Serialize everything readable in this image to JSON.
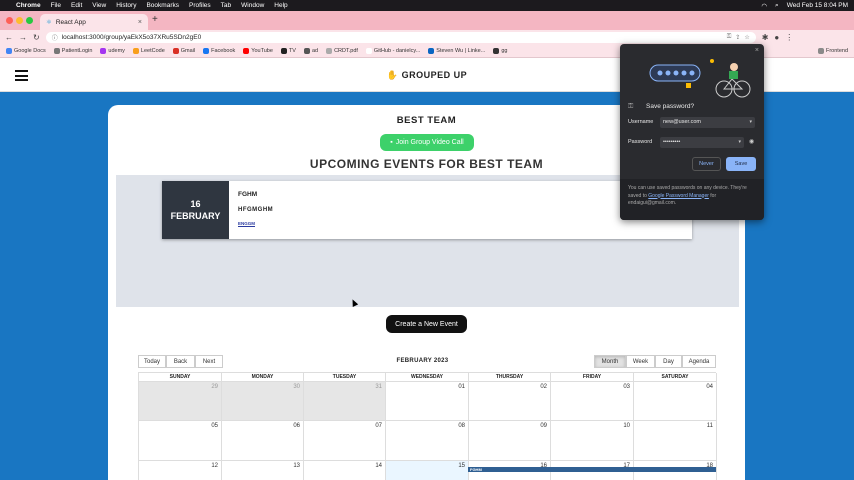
{
  "mac_menubar": {
    "app": "Chrome",
    "menus": [
      "File",
      "Edit",
      "View",
      "History",
      "Bookmarks",
      "Profiles",
      "Tab",
      "Window",
      "Help"
    ],
    "datetime": "Wed Feb 15  8:04 PM"
  },
  "browser": {
    "tab_title": "React App",
    "url": "localhost:3000/group/yaEkX5o37XRu5SDn2gE0",
    "bookmarks": [
      "Google Docs",
      "PatientLogin",
      "udemy",
      "LeetCode",
      "Gmail",
      "Facebook",
      "YouTube",
      "TV",
      "ad",
      "CRDT.pdf",
      "GitHub - danielcy...",
      "Steven Wu | Linke...",
      "gg",
      "Frontend"
    ]
  },
  "app": {
    "logo_text": "GROUPED UP",
    "team_name": "BEST TEAM",
    "video_call_label": "Join Group Video Call",
    "upcoming_title": "UPCOMING EVENTS FOR BEST TEAM",
    "create_event_label": "Create a New Event"
  },
  "event": {
    "day": "16",
    "month": "FEBRUARY",
    "title": "FGHM",
    "description": "HFGMGHM",
    "link": "ENGGM"
  },
  "calendar": {
    "nav_buttons": [
      "Today",
      "Back",
      "Next"
    ],
    "view_buttons": [
      "Month",
      "Week",
      "Day",
      "Agenda"
    ],
    "active_view": "Month",
    "month_title": "FEBRUARY 2023",
    "weekdays": [
      "SUNDAY",
      "MONDAY",
      "TUESDAY",
      "WEDNESDAY",
      "THURSDAY",
      "FRIDAY",
      "SATURDAY"
    ],
    "weeks": [
      [
        "29",
        "30",
        "31",
        "01",
        "02",
        "03",
        "04"
      ],
      [
        "05",
        "06",
        "07",
        "08",
        "09",
        "10",
        "11"
      ],
      [
        "12",
        "13",
        "14",
        "15",
        "16",
        "17",
        "18"
      ]
    ],
    "event_label": "FGHM"
  },
  "password_popup": {
    "heading": "Save password?",
    "username_label": "Username",
    "username_value": "new@user.com",
    "password_label": "Password",
    "password_value": "•••••••••",
    "never_label": "Never",
    "save_label": "Save",
    "footer_text": "You can use saved passwords on any device. They're saved to",
    "footer_link": "Google Password Manager",
    "footer_for": "for",
    "footer_account": "endaigui@gmail.com."
  }
}
